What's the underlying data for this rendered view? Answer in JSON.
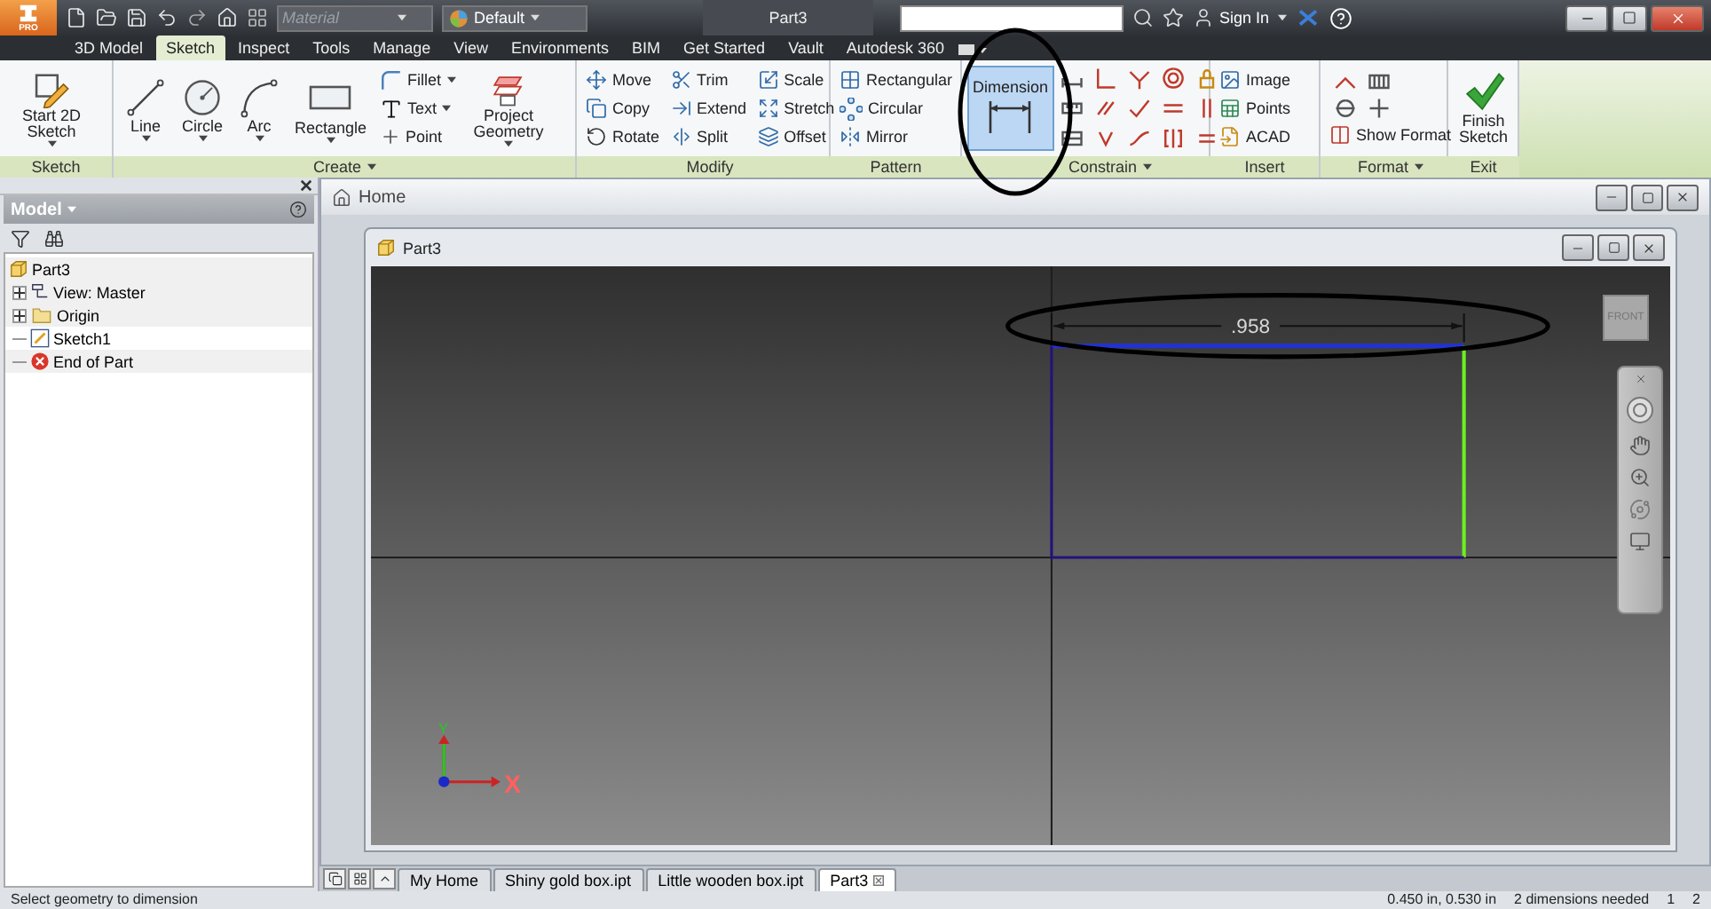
{
  "title_bar": {
    "app_badge": "PRO",
    "material": {
      "placeholder": "Material"
    },
    "appearance": "Default",
    "document_title": "Part3",
    "sign_in": "Sign In"
  },
  "ribbon_tabs": [
    {
      "label": "3D Model",
      "selected": false
    },
    {
      "label": "Sketch",
      "selected": true
    },
    {
      "label": "Inspect",
      "selected": false
    },
    {
      "label": "Tools",
      "selected": false
    },
    {
      "label": "Manage",
      "selected": false
    },
    {
      "label": "View",
      "selected": false
    },
    {
      "label": "Environments",
      "selected": false
    },
    {
      "label": "BIM",
      "selected": false
    },
    {
      "label": "Get Started",
      "selected": false
    },
    {
      "label": "Vault",
      "selected": false
    },
    {
      "label": "Autodesk 360",
      "selected": false
    }
  ],
  "ribbon_panels": [
    {
      "title": "Sketch",
      "menu": false,
      "tools": [
        {
          "kind": "large",
          "label": "Start 2D Sketch",
          "dropdown": true,
          "active": false
        }
      ]
    },
    {
      "title": "Create",
      "menu": true,
      "tools": [
        {
          "kind": "large",
          "label": "Line",
          "dropdown": true,
          "active": false
        },
        {
          "kind": "large",
          "label": "Circle",
          "dropdown": true,
          "active": false
        },
        {
          "kind": "large",
          "label": "Arc",
          "dropdown": true,
          "active": false
        },
        {
          "kind": "large",
          "label": "Rectangle",
          "dropdown": true,
          "active": false
        },
        {
          "kind": "column",
          "items": [
            {
              "label": "Fillet",
              "dropdown": true
            },
            {
              "label": "Text",
              "dropdown": true
            },
            {
              "label": "Point",
              "dropdown": false
            }
          ]
        },
        {
          "kind": "large",
          "label": "Project Geometry",
          "dropdown": true,
          "active": false
        }
      ]
    },
    {
      "title": "Modify",
      "menu": false,
      "tools": [
        {
          "kind": "column",
          "items": [
            {
              "label": "Move",
              "dropdown": false
            },
            {
              "label": "Copy",
              "dropdown": false
            },
            {
              "label": "Rotate",
              "dropdown": false
            }
          ]
        },
        {
          "kind": "column",
          "items": [
            {
              "label": "Trim",
              "dropdown": false
            },
            {
              "label": "Extend",
              "dropdown": false
            },
            {
              "label": "Split",
              "dropdown": false
            }
          ]
        },
        {
          "kind": "column",
          "items": [
            {
              "label": "Scale",
              "dropdown": false
            },
            {
              "label": "Stretch",
              "dropdown": false
            },
            {
              "label": "Offset",
              "dropdown": false
            }
          ]
        }
      ]
    },
    {
      "title": "Pattern",
      "menu": false,
      "tools": [
        {
          "kind": "column",
          "items": [
            {
              "label": "Rectangular",
              "dropdown": false
            },
            {
              "label": "Circular",
              "dropdown": false
            },
            {
              "label": "Mirror",
              "dropdown": false
            }
          ]
        }
      ]
    },
    {
      "title": "Constrain",
      "menu": true,
      "tools": [
        {
          "kind": "large",
          "label": "Dimension",
          "dropdown": false,
          "active": true
        },
        {
          "kind": "icon_grid"
        }
      ]
    },
    {
      "title": "Insert",
      "menu": false,
      "tools": [
        {
          "kind": "column",
          "items": [
            {
              "label": "Image",
              "dropdown": false
            },
            {
              "label": "Points",
              "dropdown": false
            },
            {
              "label": "ACAD",
              "dropdown": false
            }
          ]
        }
      ]
    },
    {
      "title": "Format",
      "menu": true,
      "tools": [
        {
          "kind": "format_stack",
          "label": "Show Format"
        }
      ]
    },
    {
      "title": "Exit",
      "menu": false,
      "tools": [
        {
          "kind": "large",
          "label": "Finish Sketch",
          "dropdown": false,
          "active": false
        }
      ]
    }
  ],
  "browser": {
    "title": "Model",
    "tree": [
      {
        "label": "Part3",
        "kind": "part",
        "children": [
          {
            "label": "View: Master",
            "kind": "view",
            "expanded": false
          },
          {
            "label": "Origin",
            "kind": "folder",
            "expanded": false
          },
          {
            "label": "Sketch1",
            "kind": "sketch"
          },
          {
            "label": "End of Part",
            "kind": "end"
          }
        ]
      }
    ]
  },
  "home_window": {
    "title": "Home"
  },
  "document_window": {
    "title": "Part3",
    "dimension": ".958",
    "view_cube": "FRONT",
    "triad": {
      "y": "Y",
      "x": "X"
    }
  },
  "document_tabs": [
    {
      "label": "My Home",
      "selected": false
    },
    {
      "label": "Shiny gold box.ipt",
      "selected": false
    },
    {
      "label": "Little wooden box.ipt",
      "selected": false
    },
    {
      "label": "Part3",
      "selected": true
    }
  ],
  "status_bar": {
    "prompt": "Select geometry to dimension",
    "coordinates": "0.450 in, 0.530 in",
    "message": "2 dimensions needed",
    "counters": [
      "1",
      "2"
    ]
  }
}
